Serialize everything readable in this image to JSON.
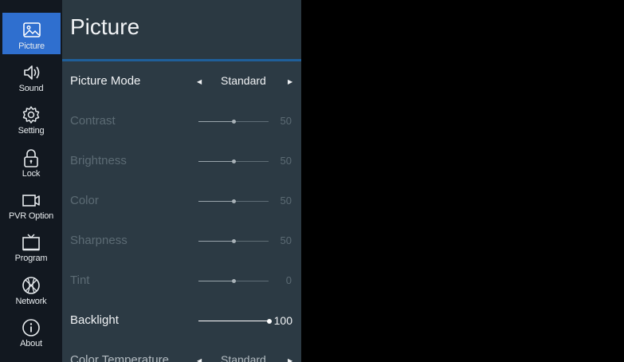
{
  "sidebar": {
    "items": [
      {
        "label": "Picture",
        "icon": "picture-icon",
        "active": true
      },
      {
        "label": "Sound",
        "icon": "speaker-icon",
        "active": false
      },
      {
        "label": "Setting",
        "icon": "gear-icon",
        "active": false
      },
      {
        "label": "Lock",
        "icon": "lock-icon",
        "active": false
      },
      {
        "label": "PVR Option",
        "icon": "video-camera-icon",
        "active": false
      },
      {
        "label": "Program",
        "icon": "tv-icon",
        "active": false
      },
      {
        "label": "Network",
        "icon": "globe-icon",
        "active": false
      },
      {
        "label": "About",
        "icon": "info-icon",
        "active": false
      }
    ]
  },
  "panel": {
    "title": "Picture",
    "accent_color": "#2f6fcf",
    "rows": [
      {
        "name": "Picture Mode",
        "type": "select",
        "value": "Standard",
        "enabled": true
      },
      {
        "name": "Contrast",
        "type": "slider",
        "value": 50,
        "max": 100,
        "display": "50",
        "enabled": false
      },
      {
        "name": "Brightness",
        "type": "slider",
        "value": 50,
        "max": 100,
        "display": "50",
        "enabled": false
      },
      {
        "name": "Color",
        "type": "slider",
        "value": 50,
        "max": 100,
        "display": "50",
        "enabled": false
      },
      {
        "name": "Sharpness",
        "type": "slider",
        "value": 50,
        "max": 100,
        "display": "50",
        "enabled": false
      },
      {
        "name": "Tint",
        "type": "slider",
        "value": 0,
        "max": 100,
        "display": "0",
        "enabled": false
      },
      {
        "name": "Backlight",
        "type": "slider",
        "value": 100,
        "max": 100,
        "display": "100",
        "enabled": true
      },
      {
        "name": "Color Temperature",
        "type": "select",
        "value": "Standard",
        "enabled": true
      }
    ]
  }
}
